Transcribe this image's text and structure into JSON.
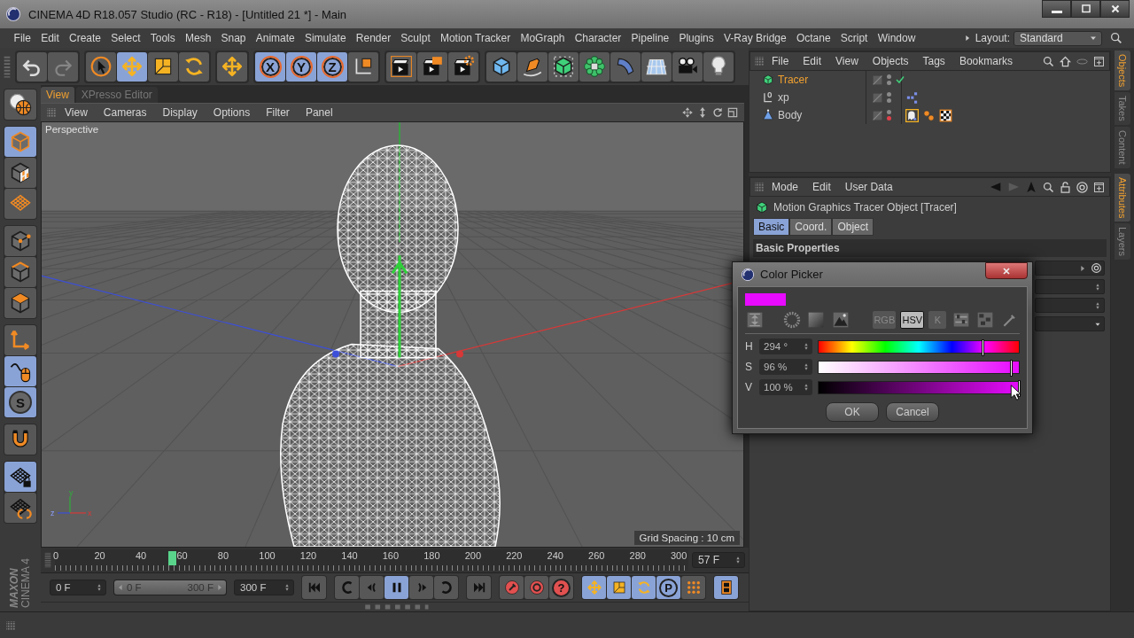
{
  "window": {
    "title": "CINEMA 4D R18.057 Studio (RC - R18) - [Untitled 21 *] - Main"
  },
  "menu_bar": [
    "File",
    "Edit",
    "Create",
    "Select",
    "Tools",
    "Mesh",
    "Snap",
    "Animate",
    "Simulate",
    "Render",
    "Sculpt",
    "Motion Tracker",
    "MoGraph",
    "Character",
    "Pipeline",
    "Plugins",
    "V-Ray Bridge",
    "Octane",
    "Script",
    "Window"
  ],
  "layout": {
    "label": "Layout:",
    "value": "Standard"
  },
  "toolbar": [
    {
      "items": [
        {
          "kind": "undo",
          "selected": false,
          "disabled": false
        },
        {
          "kind": "redo",
          "selected": false,
          "disabled": true
        }
      ]
    },
    {
      "items": [
        {
          "kind": "select",
          "selected": false,
          "disabled": false
        },
        {
          "kind": "move",
          "selected": true,
          "disabled": false
        },
        {
          "kind": "scale",
          "selected": false,
          "disabled": false
        },
        {
          "kind": "rotate",
          "selected": false,
          "disabled": false
        }
      ]
    },
    {
      "items": [
        {
          "kind": "move",
          "selected": false,
          "disabled": false
        }
      ]
    },
    {
      "items": [
        {
          "kind": "letter",
          "label": "X",
          "selected": true,
          "disabled": false
        },
        {
          "kind": "letter",
          "label": "Y",
          "selected": true,
          "disabled": false
        },
        {
          "kind": "letter",
          "label": "Z",
          "selected": true,
          "disabled": false
        },
        {
          "kind": "coord",
          "selected": false,
          "disabled": false
        }
      ]
    },
    {
      "items": [
        {
          "kind": "render-view",
          "selected": false,
          "disabled": false
        },
        {
          "kind": "render-viewer",
          "selected": false,
          "disabled": false
        },
        {
          "kind": "render-settings",
          "selected": false,
          "disabled": false
        }
      ]
    },
    {
      "items": [
        {
          "kind": "cube",
          "selected": false,
          "disabled": false
        },
        {
          "kind": "pen",
          "selected": false,
          "disabled": false
        },
        {
          "kind": "subdiv",
          "selected": false,
          "disabled": false
        },
        {
          "kind": "cloner",
          "selected": false,
          "disabled": false
        },
        {
          "kind": "bend",
          "selected": false,
          "disabled": false
        },
        {
          "kind": "floor",
          "selected": false,
          "disabled": false
        },
        {
          "kind": "camera",
          "selected": false,
          "disabled": false
        },
        {
          "kind": "light",
          "selected": false,
          "disabled": false
        }
      ]
    }
  ],
  "tool_palette": [
    {
      "items": [
        {
          "kind": "globe",
          "selected": false
        }
      ]
    },
    {
      "items": [
        {
          "kind": "model",
          "selected": true
        },
        {
          "kind": "texture",
          "selected": false
        },
        {
          "kind": "workplane",
          "selected": false
        }
      ]
    },
    {
      "items": [
        {
          "kind": "points",
          "selected": false
        },
        {
          "kind": "edges",
          "selected": false
        },
        {
          "kind": "polygons",
          "selected": false
        }
      ]
    },
    {
      "items": [
        {
          "kind": "axis",
          "selected": false
        },
        {
          "kind": "tweak",
          "selected": true
        },
        {
          "kind": "letter",
          "label": "S",
          "selected": true
        }
      ]
    },
    {
      "items": [
        {
          "kind": "snap",
          "selected": false
        }
      ]
    },
    {
      "items": [
        {
          "kind": "lock-workplane",
          "selected": true
        },
        {
          "kind": "planar",
          "selected": false
        }
      ]
    }
  ],
  "logo": {
    "brand": "MAXON",
    "product": "CINEMA 4"
  },
  "viewport": {
    "tabs": [
      {
        "label": "View",
        "selected": true
      },
      {
        "label": "XPresso Editor",
        "selected": false
      }
    ],
    "menu": [
      "View",
      "Cameras",
      "Display",
      "Options",
      "Filter",
      "Panel"
    ],
    "camera": "Perspective",
    "grid_spacing": "Grid Spacing : 10 cm",
    "gizmo_labels": [
      "y",
      "z",
      "x"
    ]
  },
  "timeline": {
    "ticks": [
      "0",
      "20",
      "40",
      "60",
      "80",
      "100",
      "120",
      "140",
      "160",
      "180",
      "200",
      "220",
      "240",
      "260",
      "280",
      "300"
    ],
    "level": 0.19,
    "current_frame": "57 F"
  },
  "transport": {
    "start": "0 F",
    "range": {
      "start": "0 F",
      "end": "300 F",
      "level": 1
    },
    "end": "300 F",
    "groups": [
      {
        "items": [
          {
            "kind": "start",
            "selected": false
          }
        ]
      },
      {
        "items": [
          {
            "kind": "prevkey",
            "selected": false
          },
          {
            "kind": "prevframe",
            "selected": false
          },
          {
            "kind": "pause",
            "selected": true
          },
          {
            "kind": "nextframe",
            "selected": false
          },
          {
            "kind": "nextkey",
            "selected": false
          }
        ]
      },
      {
        "items": [
          {
            "kind": "end",
            "selected": false
          }
        ]
      },
      {
        "items": [
          {
            "kind": "record",
            "selected": false
          },
          {
            "kind": "autokey",
            "selected": false
          },
          {
            "kind": "letter",
            "label": "?",
            "selected": false
          }
        ]
      },
      {
        "items": [
          {
            "kind": "move",
            "selected": true
          },
          {
            "kind": "scale",
            "selected": true
          },
          {
            "kind": "rotate",
            "selected": true
          },
          {
            "kind": "letter",
            "label": "P",
            "selected": true
          },
          {
            "kind": "dots",
            "selected": false
          }
        ]
      },
      {
        "items": [
          {
            "kind": "film",
            "selected": true
          }
        ]
      }
    ]
  },
  "objects": {
    "menu": [
      "File",
      "Edit",
      "View",
      "Objects",
      "Tags",
      "Bookmarks"
    ],
    "items": [
      {
        "kind": "tracer",
        "name": "Tracer",
        "selected": true,
        "checked": true,
        "color": "#8a8a8a"
      },
      {
        "kind": "null",
        "name": "xp",
        "selected": false,
        "checked": false,
        "color": "#8a8a8a",
        "tags": [
          {
            "kind": "xpresso"
          }
        ]
      },
      {
        "kind": "polygon",
        "name": "Body",
        "selected": false,
        "checked": false,
        "color": "#e0404a",
        "tags": [
          {
            "kind": "ghost"
          },
          {
            "kind": "spheres"
          },
          {
            "kind": "checker"
          }
        ]
      }
    ]
  },
  "side_tabs_top": [
    {
      "label": "Objects",
      "selected": true
    },
    {
      "label": "Takes",
      "selected": false
    },
    {
      "label": "Content",
      "selected": false
    }
  ],
  "side_tabs_bottom": [
    {
      "label": "Attributes",
      "selected": true
    },
    {
      "label": "Layers",
      "selected": false
    }
  ],
  "attributes": {
    "menu": [
      "Mode",
      "Edit",
      "User Data"
    ],
    "title": "Motion Graphics Tracer Object [Tracer]",
    "tabs": [
      {
        "label": "Basic",
        "selected": true
      },
      {
        "label": "Coord.",
        "selected": false
      },
      {
        "label": "Object",
        "selected": false
      }
    ],
    "section": "Basic Properties"
  },
  "color_picker": {
    "title": "Color Picker",
    "color": "#e70aff",
    "modes": [
      {
        "kind": "mixer",
        "selected": false
      },
      {
        "kind": "wheel",
        "selected": false
      },
      {
        "kind": "spectrum",
        "selected": false
      },
      {
        "kind": "image",
        "selected": false
      },
      {
        "kind": "text",
        "label": "RGB",
        "selected": false
      },
      {
        "kind": "text",
        "label": "HSV",
        "selected": true
      },
      {
        "kind": "text",
        "label": "K",
        "selected": false
      },
      {
        "kind": "sliders",
        "selected": false
      },
      {
        "kind": "swatches",
        "selected": false
      },
      {
        "kind": "dropper",
        "selected": false
      }
    ],
    "channels": [
      {
        "kind": "hue",
        "name": "H",
        "value": "294 °",
        "level": 0.817
      },
      {
        "kind": "saturation",
        "name": "S",
        "value": "96 %",
        "level": 0.96
      },
      {
        "kind": "value",
        "name": "V",
        "value": "100 %",
        "level": 1
      }
    ],
    "buttons": [
      "OK",
      "Cancel"
    ]
  }
}
